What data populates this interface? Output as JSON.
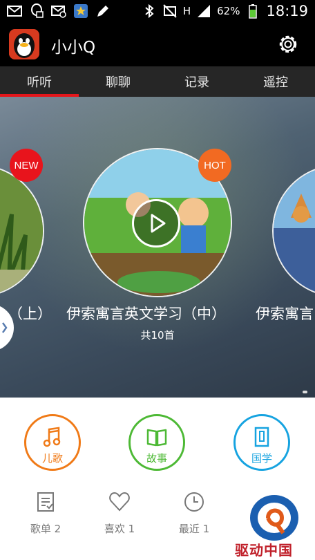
{
  "status_bar": {
    "network_type": "H",
    "battery": "62%",
    "time": "18:19"
  },
  "header": {
    "title": "小小Q"
  },
  "tabs": [
    {
      "label": "听听",
      "active": true
    },
    {
      "label": "聊聊",
      "active": false
    },
    {
      "label": "记录",
      "active": false
    },
    {
      "label": "遥控",
      "active": false
    }
  ],
  "carousel": {
    "badges": {
      "new": "NEW",
      "hot": "HOT"
    },
    "titles": {
      "left": "（上）",
      "center": "伊索寓言英文学习（中）",
      "right": "伊索寓言"
    },
    "count": "共10首"
  },
  "categories": [
    {
      "label": "儿歌",
      "color": "#f07a17"
    },
    {
      "label": "故事",
      "color": "#4db935"
    },
    {
      "label": "国学",
      "color": "#16a3e0"
    }
  ],
  "bottom_items": [
    {
      "label": "歌单 2"
    },
    {
      "label": "喜欢 1"
    },
    {
      "label": "最近 1"
    }
  ],
  "watermark": {
    "text": "驱动中国"
  },
  "colors": {
    "accent_red": "#e4161b",
    "tab_bg": "#262626"
  }
}
